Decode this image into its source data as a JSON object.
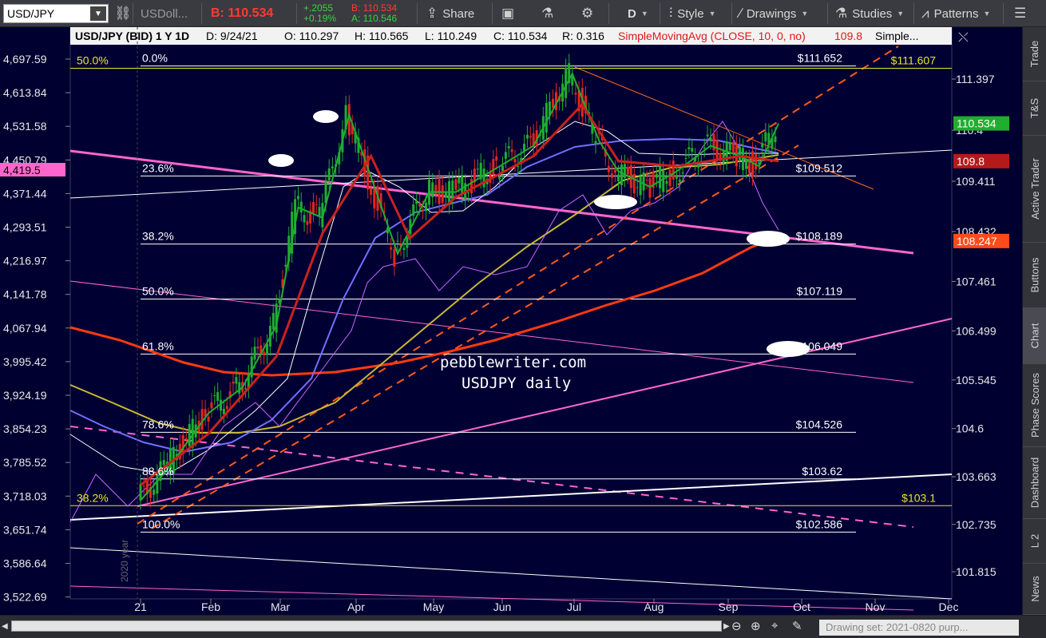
{
  "toolbar": {
    "symbol": "USD/JPY",
    "symbol_caret": "▼",
    "compare_symbol": "USDoll...",
    "bid_big": "B: 110.534",
    "change_abs": "+.2055",
    "change_pct": "+0.19%",
    "bid_small": "B: 110.534",
    "ask_small": "A: 110.546",
    "share_label": "Share",
    "period_label": "D",
    "style_label": "Style",
    "drawings_label": "Drawings",
    "studies_label": "Studies",
    "patterns_label": "Patterns"
  },
  "chart_header": {
    "title": "USD/JPY (BID) 1 Y 1D",
    "date": "D: 9/24/21",
    "open": "O: 110.297",
    "high": "H: 110.565",
    "low": "L: 110.249",
    "close": "C: 110.534",
    "range": "R: 0.316",
    "study": "SimpleMovingAvg (CLOSE, 10, 0, no)",
    "study_value": "109.8",
    "more": "Simple..."
  },
  "chart_data": {
    "type": "line",
    "symbol": "USD/JPY",
    "period": "1 Y 1D",
    "watermark": [
      "pebblewriter.com",
      "USDJPY daily"
    ],
    "year_marker": "2020 year",
    "x_labels": [
      "21",
      "Feb",
      "Mar",
      "Apr",
      "May",
      "Jun",
      "Jul",
      "Aug",
      "Sep",
      "Oct",
      "Nov",
      "Dec"
    ],
    "right_axis_ticks": [
      "111.397",
      "110.4",
      "109.411",
      "108.432",
      "107.461",
      "106.499",
      "105.545",
      "104.6",
      "103.663",
      "102.735",
      "101.815"
    ],
    "left_axis_ticks": [
      "4,697.59",
      "4,613.84",
      "4,531.58",
      "4,450.79",
      "4,371.44",
      "4,293.51",
      "4,216.97",
      "4,141.78",
      "4,067.94",
      "3,995.42",
      "3,924.19",
      "3,854.23",
      "3,785.52",
      "3,718.03",
      "3,651.74",
      "3,586.64",
      "3,522.69"
    ],
    "left_axis_badge": "4,419.5",
    "right_badges": [
      {
        "label": "110.534",
        "color": "#1fae2e"
      },
      {
        "label": "109.8",
        "color": "#b51a1a"
      },
      {
        "label": "108.247",
        "color": "#ff4a1a"
      }
    ],
    "fib_levels": [
      {
        "pct": "0.0%",
        "price": "$111.652"
      },
      {
        "pct": "23.6%",
        "price": "$109.512"
      },
      {
        "pct": "38.2%",
        "price": "$108.189"
      },
      {
        "pct": "50.0%",
        "price": "$107.119"
      },
      {
        "pct": "61.8%",
        "price": "$106.049"
      },
      {
        "pct": "78.6%",
        "price": "$104.526"
      },
      {
        "pct": "88.6%",
        "price": "$103.62"
      },
      {
        "pct": "100.0%",
        "price": "$102.586"
      }
    ],
    "yellow_levels": [
      {
        "left_label": "50.0%",
        "right_label": "$111.607"
      },
      {
        "left_label": "38.2%",
        "right_label": "$103.1"
      }
    ],
    "series": [
      {
        "name": "USD/JPY",
        "color": "#1fae2e",
        "x": [
          "2021-01-04",
          "2021-01-15",
          "2021-02-01",
          "2021-02-15",
          "2021-03-01",
          "2021-03-10",
          "2021-03-20",
          "2021-03-31",
          "2021-04-09",
          "2021-04-20",
          "2021-05-03",
          "2021-05-14",
          "2021-06-01",
          "2021-06-15",
          "2021-07-01",
          "2021-07-12",
          "2021-07-20",
          "2021-08-02",
          "2021-08-13",
          "2021-08-27",
          "2021-09-08",
          "2021-09-16",
          "2021-09-24"
        ],
        "values": [
          103.2,
          103.8,
          104.9,
          105.4,
          106.6,
          108.9,
          108.7,
          110.7,
          109.5,
          108.0,
          109.2,
          109.2,
          109.7,
          110.1,
          111.5,
          110.2,
          109.6,
          109.3,
          109.6,
          110.1,
          109.9,
          109.7,
          110.534
        ]
      },
      {
        "name": "SimpleMovingAvg (CLOSE, 10, 0, no)",
        "color": "#c9221c",
        "x": [
          "2021-01-04",
          "2021-02-01",
          "2021-03-01",
          "2021-03-20",
          "2021-04-09",
          "2021-04-25",
          "2021-05-14",
          "2021-06-15",
          "2021-07-05",
          "2021-07-20",
          "2021-08-13",
          "2021-09-08",
          "2021-09-24"
        ],
        "values": [
          103.5,
          104.5,
          106.0,
          108.4,
          109.9,
          108.3,
          109.1,
          109.9,
          110.9,
          109.8,
          109.7,
          109.9,
          109.8
        ]
      }
    ],
    "legend": "top-left",
    "grid": false
  },
  "sidetabs": [
    "Trade",
    "T&S",
    "Active Trader",
    "Buttons",
    "Chart",
    "Phase Scores",
    "Dashboard",
    "L 2",
    "News"
  ],
  "bottombar": {
    "drawing_set": "Drawing set: 2021-0820 purp..."
  }
}
